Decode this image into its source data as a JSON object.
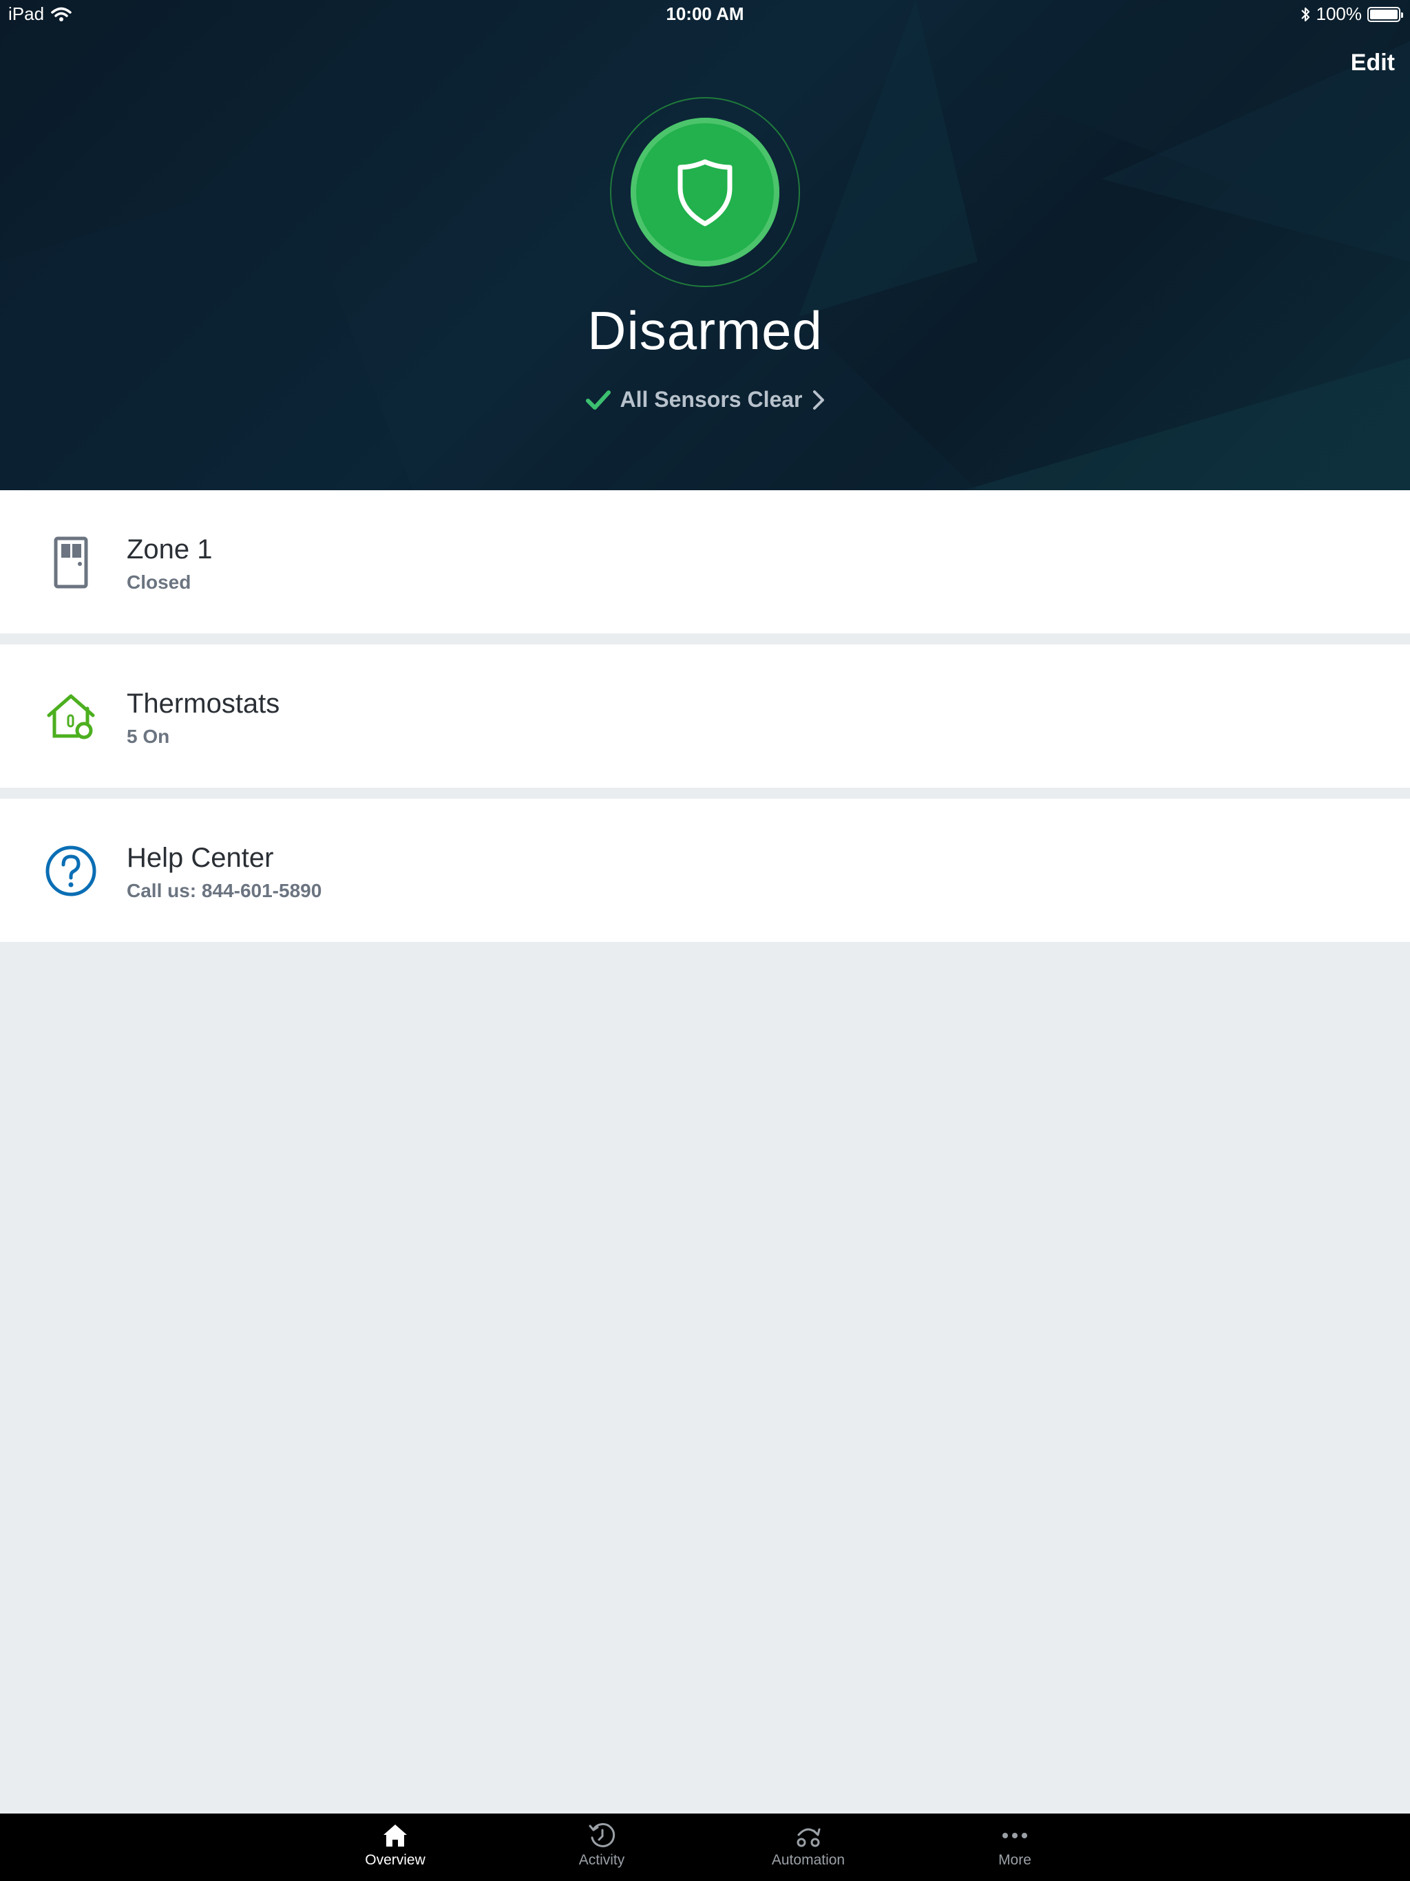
{
  "status_bar": {
    "device": "iPad",
    "time": "10:00 AM",
    "battery": "100%"
  },
  "header": {
    "edit_label": "Edit",
    "status_title": "Disarmed",
    "sensors_label": "All Sensors Clear"
  },
  "cards": [
    {
      "title": "Zone 1",
      "subtitle": "Closed",
      "icon": "door-icon"
    },
    {
      "title": "Thermostats",
      "subtitle": "5 On",
      "icon": "thermostat-house-icon"
    },
    {
      "title": "Help Center",
      "subtitle": "Call us: 844-601-5890",
      "icon": "help-icon"
    }
  ],
  "tabs": [
    {
      "label": "Overview",
      "icon": "home-icon",
      "active": true
    },
    {
      "label": "Activity",
      "icon": "history-icon",
      "active": false
    },
    {
      "label": "Automation",
      "icon": "automation-icon",
      "active": false
    },
    {
      "label": "More",
      "icon": "more-icon",
      "active": false
    }
  ],
  "colors": {
    "armed_status_green": "#22b14c",
    "thermostat_green": "#4caf1f",
    "help_blue": "#0a6eb4",
    "check_green": "#3cc070"
  }
}
